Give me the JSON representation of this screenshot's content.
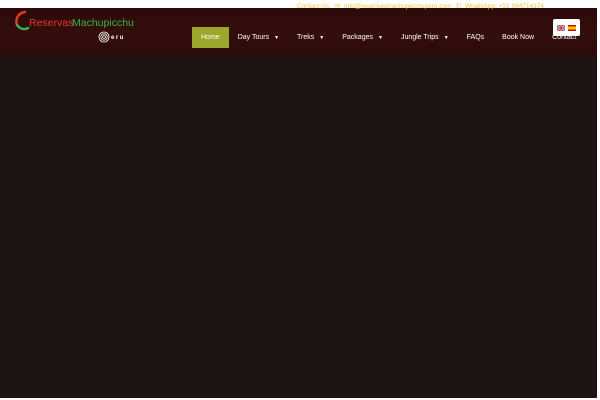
{
  "contact": {
    "label": "Contact Us:",
    "email": "info@reservasmachupicchuperu.com",
    "whatsapp": "WhatsApp: +51 984714374",
    "email_icon": "envelope-icon",
    "phone_icon": "phone-icon"
  },
  "logo": {
    "word1": "Reservas",
    "word2": "Machupicchu",
    "word3": "eru"
  },
  "nav": {
    "items": [
      {
        "label": "Home",
        "active": true
      },
      {
        "label": "Day Tours",
        "dropdown": true
      },
      {
        "label": "Treks",
        "dropdown": true
      },
      {
        "label": "Packages",
        "dropdown": true
      },
      {
        "label": "Jungle Trips",
        "dropdown": true
      },
      {
        "label": "FAQs"
      },
      {
        "label": "Book Now"
      },
      {
        "label": "Contact"
      }
    ]
  },
  "language": {
    "options": [
      "English",
      "Spanish"
    ],
    "icons": [
      "uk-flag-icon",
      "spain-flag-icon"
    ]
  },
  "colors": {
    "header_bg": "#340e0c",
    "body_bg": "#1d1413",
    "active_nav": "#9ba72a",
    "contact_text": "#e6c84a",
    "logo_red": "#e33a2a",
    "logo_green": "#3ab24a"
  }
}
